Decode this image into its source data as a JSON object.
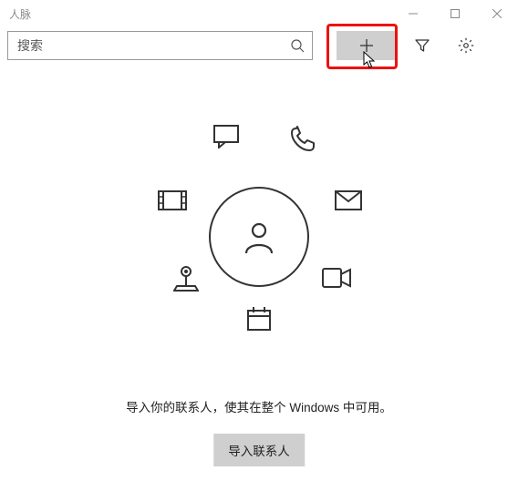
{
  "window": {
    "title": "人脉"
  },
  "toolbar": {
    "search_placeholder": "搜索",
    "search_value": ""
  },
  "icons": {
    "search": "search-icon",
    "add": "plus-icon",
    "filter": "filter-icon",
    "settings": "gear-icon",
    "minimize": "minimize-icon",
    "maximize": "maximize-icon",
    "close": "close-icon",
    "person": "person-icon",
    "chat": "chat-icon",
    "phone": "phone-icon",
    "mail": "mail-icon",
    "video": "video-icon",
    "calendar": "calendar-icon",
    "location": "location-pin-icon",
    "film": "film-icon"
  },
  "main": {
    "caption": "导入你的联系人，使其在整个 Windows 中可用。",
    "import_label": "导入联系人"
  }
}
